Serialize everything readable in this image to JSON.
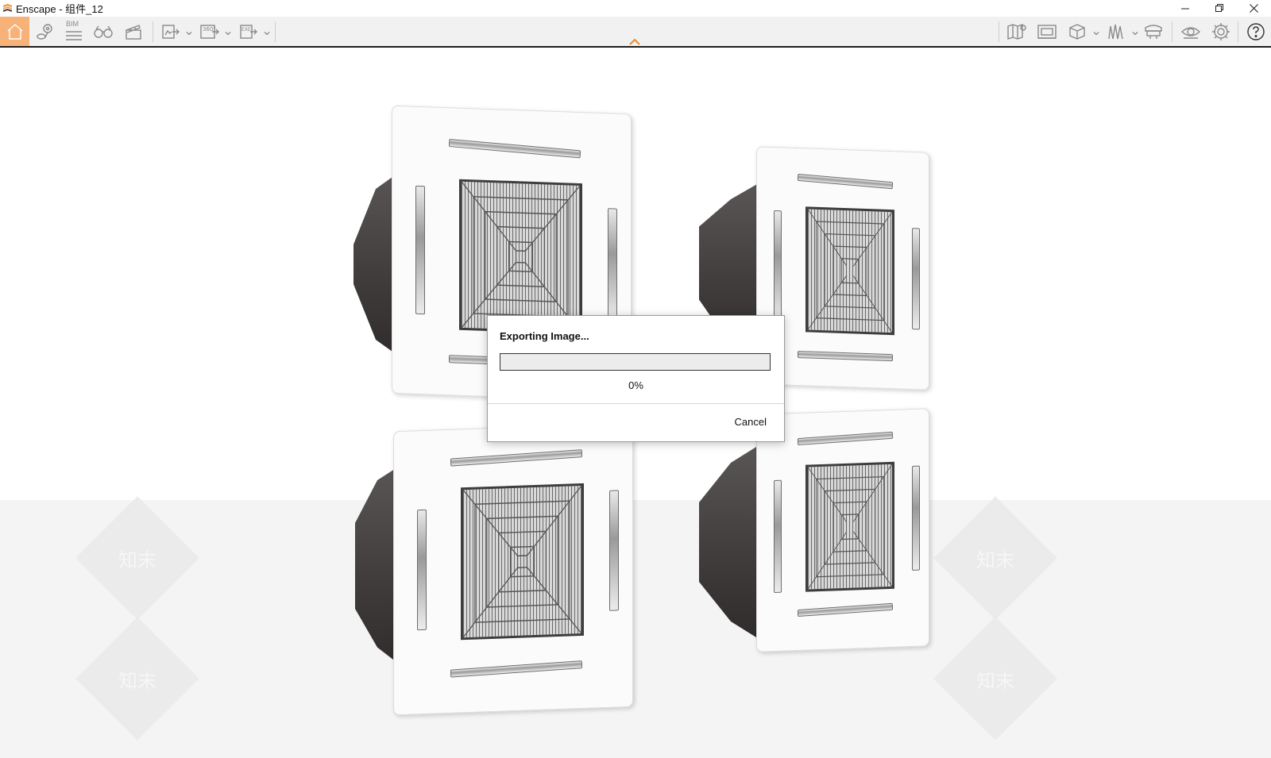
{
  "window": {
    "title": "Enscape - 组件_12"
  },
  "toolbar": {
    "left_tools": [
      {
        "icon": "home-icon",
        "active": true
      },
      {
        "icon": "location-pin-icon"
      },
      {
        "icon": "bim-icon",
        "label": "BIM"
      },
      {
        "icon": "binoculars-icon"
      },
      {
        "icon": "clapperboard-icon"
      },
      {
        "icon": "export-image-icon"
      },
      {
        "icon": "export-360-icon",
        "label": "360°"
      },
      {
        "icon": "export-exe-icon",
        "label": "EXE"
      }
    ],
    "right_tools": [
      {
        "icon": "map-icon"
      },
      {
        "icon": "screenshots-icon"
      },
      {
        "icon": "cube-icon"
      },
      {
        "icon": "grass-icon"
      },
      {
        "icon": "asset-library-icon"
      },
      {
        "icon": "eye-icon"
      },
      {
        "icon": "gear-icon"
      },
      {
        "icon": "help-icon"
      }
    ],
    "accent_color": "#f7b27a"
  },
  "dialog": {
    "title": "Exporting Image...",
    "progress_percent": 0,
    "progress_text": "0%",
    "cancel_label": "Cancel"
  },
  "watermark": {
    "text": "知末"
  }
}
